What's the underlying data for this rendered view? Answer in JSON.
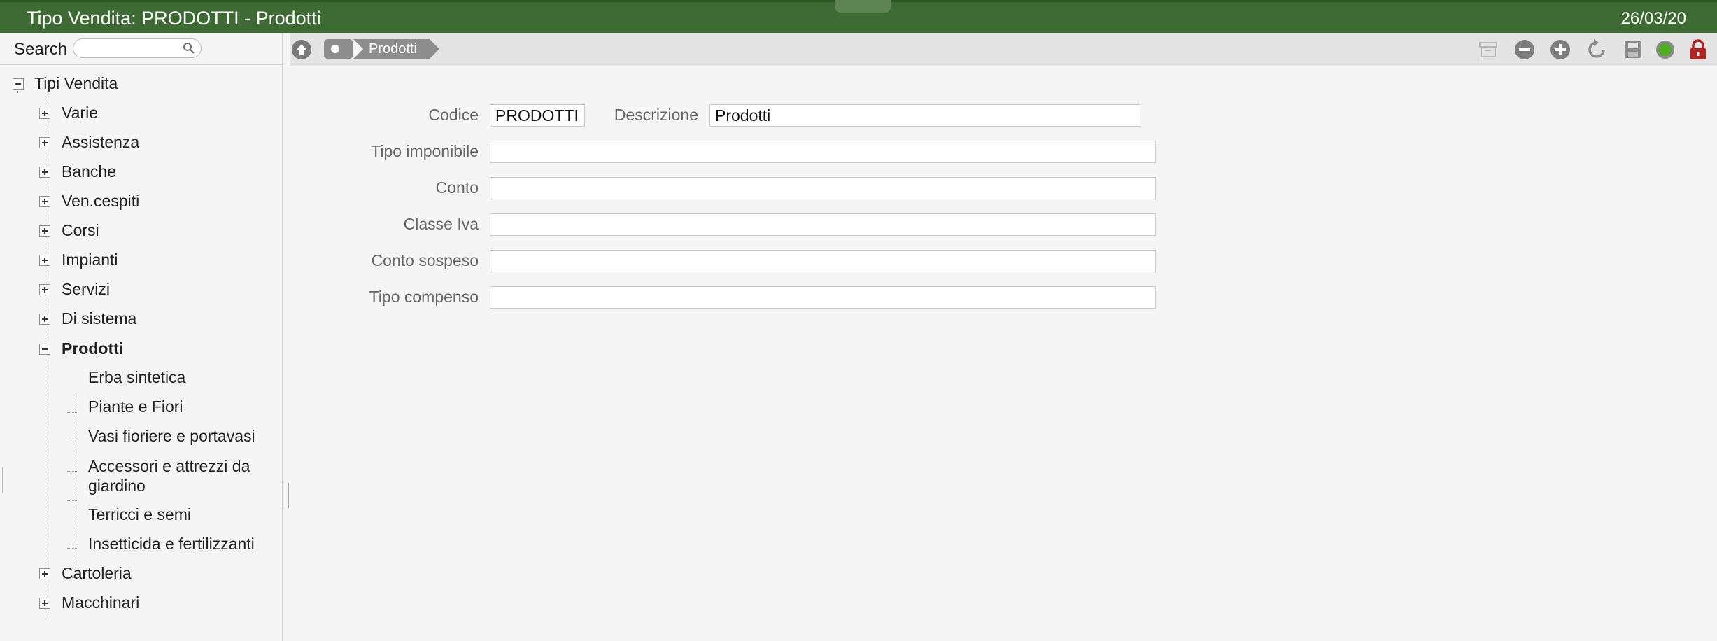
{
  "window": {
    "title": "Tipo Vendita: PRODOTTI - Prodotti",
    "date": "26/03/20"
  },
  "search": {
    "label": "Search",
    "value": ""
  },
  "tree": {
    "root": "Tipi Vendita",
    "items": [
      "Varie",
      "Assistenza",
      "Banche",
      "Ven.cespiti",
      "Corsi",
      "Impianti",
      "Servizi",
      "Di sistema"
    ],
    "expanded": {
      "label": "Prodotti",
      "children": [
        "Erba sintetica",
        "Piante e Fiori",
        "Vasi fioriere e portavasi",
        "Accessori e attrezzi da giardino",
        "Terricci e semi",
        "Insetticida e fertilizzanti"
      ]
    },
    "items_after": [
      "Cartoleria",
      "Macchinari"
    ]
  },
  "breadcrumb": {
    "current": "Prodotti"
  },
  "toolbar": {
    "icons": [
      "archive-icon",
      "remove-icon",
      "add-icon",
      "refresh-icon",
      "save-icon",
      "status-ok-icon",
      "lock-icon"
    ]
  },
  "form": {
    "codice": {
      "label": "Codice",
      "value": "PRODOTTI"
    },
    "descrizione": {
      "label": "Descrizione",
      "value": "Prodotti"
    },
    "tipo_imponibile": {
      "label": "Tipo imponibile",
      "value": ""
    },
    "conto": {
      "label": "Conto",
      "value": ""
    },
    "classe_iva": {
      "label": "Classe Iva",
      "value": ""
    },
    "conto_sospeso": {
      "label": "Conto sospeso",
      "value": ""
    },
    "tipo_compenso": {
      "label": "Tipo compenso",
      "value": ""
    }
  },
  "colors": {
    "titlebar": "#3d6a32",
    "accent_red": "#b22222",
    "status_green": "#4caf1f"
  }
}
